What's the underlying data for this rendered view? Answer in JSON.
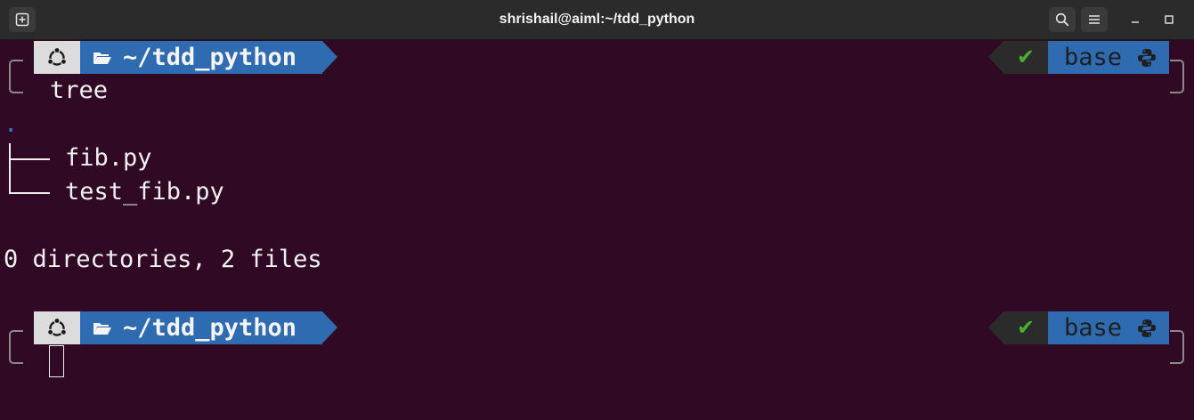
{
  "window": {
    "title": "shrishail@aiml:~/tdd_python",
    "buttons": [
      "new-tab-icon",
      "search-icon",
      "hamburger-menu-icon",
      "minimize-icon",
      "maximize-icon"
    ]
  },
  "prompt": {
    "os_icon": "ubuntu-icon",
    "folder_icon": "folder-open-icon",
    "directory": "~/tdd_python",
    "status_symbol": "✔",
    "env_name": "base",
    "env_icon": "python-icon"
  },
  "terminal": {
    "command": "tree",
    "tree_root": ".",
    "tree_items": [
      "fib.py",
      "test_fib.py"
    ],
    "summary": "0 directories, 2 files"
  },
  "colors": {
    "terminal_bg": "#300a24",
    "segment_blue": "#2e6bb0",
    "status_green": "#4caf2f",
    "titlebar": "#2b2b2b"
  }
}
